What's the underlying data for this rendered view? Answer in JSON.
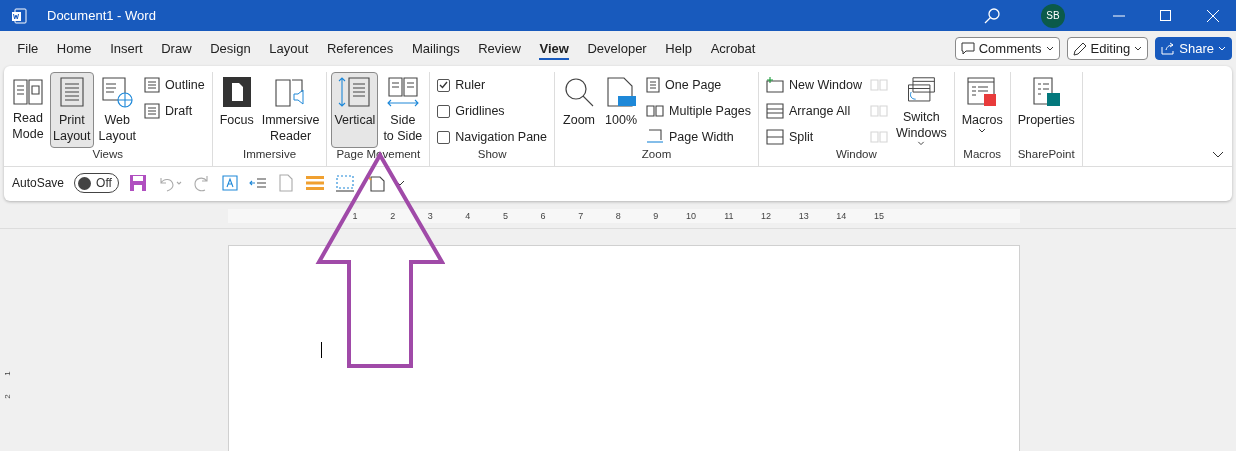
{
  "window": {
    "title": "Document1  -  Word",
    "avatar": "SB"
  },
  "tabs": [
    {
      "label": "File",
      "selected": false
    },
    {
      "label": "Home",
      "selected": false
    },
    {
      "label": "Insert",
      "selected": false
    },
    {
      "label": "Draw",
      "selected": false
    },
    {
      "label": "Design",
      "selected": false
    },
    {
      "label": "Layout",
      "selected": false
    },
    {
      "label": "References",
      "selected": false
    },
    {
      "label": "Mailings",
      "selected": false
    },
    {
      "label": "Review",
      "selected": false
    },
    {
      "label": "View",
      "selected": true
    },
    {
      "label": "Developer",
      "selected": false
    },
    {
      "label": "Help",
      "selected": false
    },
    {
      "label": "Acrobat",
      "selected": false
    }
  ],
  "header_buttons": [
    {
      "label": "Comments",
      "kind": "outline"
    },
    {
      "label": "Editing",
      "kind": "outline"
    },
    {
      "label": "Share",
      "kind": "primary"
    }
  ],
  "ribbon": [
    {
      "label": "Views",
      "items": [
        {
          "kind": "large",
          "label": "Read\nMode",
          "selected": false
        },
        {
          "kind": "large",
          "label": "Print\nLayout",
          "selected": true
        },
        {
          "kind": "large",
          "label": "Web\nLayout",
          "selected": false
        },
        {
          "kind": "stack",
          "items": [
            {
              "kind": "small",
              "label": "Outline"
            },
            {
              "kind": "small",
              "label": "Draft"
            }
          ]
        }
      ]
    },
    {
      "label": "Immersive",
      "items": [
        {
          "kind": "large",
          "label": "Focus",
          "selected": false
        },
        {
          "kind": "large",
          "label": "Immersive\nReader",
          "selected": false
        }
      ]
    },
    {
      "label": "Page Movement",
      "items": [
        {
          "kind": "large",
          "label": "Vertical",
          "selected": true
        },
        {
          "kind": "large",
          "label": "Side\nto Side",
          "selected": false
        }
      ]
    },
    {
      "label": "Show",
      "items": [
        {
          "kind": "stack",
          "items": [
            {
              "kind": "check",
              "label": "Ruler",
              "checked": true
            },
            {
              "kind": "check",
              "label": "Gridlines",
              "checked": false
            },
            {
              "kind": "check",
              "label": "Navigation Pane",
              "checked": false
            }
          ]
        }
      ]
    },
    {
      "label": "Zoom",
      "items": [
        {
          "kind": "large",
          "label": "Zoom",
          "selected": false
        },
        {
          "kind": "large",
          "label": "100%",
          "selected": false
        },
        {
          "kind": "stack",
          "items": [
            {
              "kind": "small",
              "label": "One Page"
            },
            {
              "kind": "small",
              "label": "Multiple Pages"
            },
            {
              "kind": "small",
              "label": "Page Width"
            }
          ]
        }
      ]
    },
    {
      "label": "Window",
      "items": [
        {
          "kind": "stack",
          "items": [
            {
              "kind": "small",
              "label": "New Window"
            },
            {
              "kind": "small",
              "label": "Arrange All"
            },
            {
              "kind": "small",
              "label": "Split"
            }
          ]
        },
        {
          "kind": "stack",
          "items": [
            {
              "kind": "icon",
              "disabled": true
            },
            {
              "kind": "icon",
              "disabled": true
            },
            {
              "kind": "icon",
              "disabled": true
            }
          ]
        },
        {
          "kind": "large",
          "label": "Switch\nWindows",
          "selected": false,
          "dropdown": true
        }
      ]
    },
    {
      "label": "Macros",
      "items": [
        {
          "kind": "large",
          "label": "Macros",
          "selected": false,
          "dropdown": true
        }
      ]
    },
    {
      "label": "SharePoint",
      "items": [
        {
          "kind": "large",
          "label": "Properties",
          "selected": false
        }
      ]
    }
  ],
  "quick_access": {
    "autosave_label": "AutoSave",
    "autosave_state": "Off",
    "autosave_on": false
  },
  "ruler": {
    "numbers": [
      "1",
      "2",
      "3",
      "4",
      "5",
      "6",
      "7",
      "8",
      "9",
      "10",
      "11",
      "12",
      "13",
      "14",
      "15"
    ]
  },
  "vertical_ruler": {
    "numbers": [
      "1",
      "2"
    ]
  }
}
